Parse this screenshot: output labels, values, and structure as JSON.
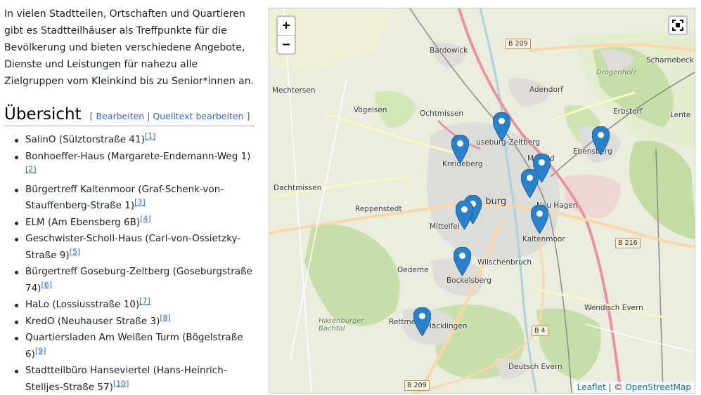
{
  "intro": "In vielen Stadtteilen, Ortschaften und Quartieren gibt es Stadtteilhäuser als Treffpunkte für die Bevölkerung und bieten verschiedene Angebote, Dienste und Leistungen für nahezu alle Zielgruppen vom Kleinkind bis zu Senior*innen an.",
  "section": {
    "title": "Übersicht",
    "bracket_open": "[",
    "edit_label": "Bearbeiten",
    "separator": "|",
    "edit_source_label": "Quelltext bearbeiten",
    "bracket_close": "]"
  },
  "items": [
    {
      "text": "SalinO (Sülztorstraße 41)",
      "ref": "[1]"
    },
    {
      "text": "Bonhoeffer-Haus (Margarete-Endemann-Weg 1)",
      "ref": "[2]"
    },
    {
      "text": "Bürgertreff Kaltenmoor (Graf-Schenk-von-Stauffenberg-Straße 1)",
      "ref": "[3]"
    },
    {
      "text": "ELM (Am Ebensberg 6B)",
      "ref": "[4]"
    },
    {
      "text": "Geschwister-Scholl-Haus (Carl-von-Ossietzky-Straße 9)",
      "ref": "[5]"
    },
    {
      "text": "Bürgertreff Goseburg-Zeltberg (Goseburgstraße 74)",
      "ref": "[6]"
    },
    {
      "text": "HaLo (Lossiusstraße 10)",
      "ref": "[7]"
    },
    {
      "text": "KredO (Neuhauser Straße 3)",
      "ref": "[8]"
    },
    {
      "text": "Quartiersladen Am Weißen Turm (Bögelstraße 6)",
      "ref": "[9]"
    },
    {
      "text": "Stadtteilbüro Hanseviertel (Hans-Heinrich-Stelljes-Straße 57)",
      "ref": "[10]"
    }
  ],
  "map": {
    "zoom_in": "+",
    "zoom_out": "−",
    "attribution_leaflet": "Leaflet",
    "attribution_sep": " | © ",
    "attribution_osm": "OpenStreetMap",
    "marker_color": "#2a81cb",
    "places": {
      "bardowick": "Bardowick",
      "scharnebeck": "Scharnebeck",
      "drogenholz": "Drogenholz",
      "mechtersen": "Mechtersen",
      "adendorf": "Adendorf",
      "vogelsen": "Vögelsen",
      "ochtmissen": "Ochtmissen",
      "erbstorf": "Erbstorf",
      "lente": "Lente",
      "goseburg": "useburg-Zeltberg",
      "kreideberg": "Kreideberg",
      "ebensberg": "Ebensberg",
      "moorfeld": "Mo   feld",
      "dachtmissen": "Dachtmissen",
      "luneburg": "L   burg",
      "neuhagen": "Neu Hagen",
      "reppenstedt": "Reppenstedt",
      "mittelfeld": "Mittelfel",
      "kaltenmoor": "Kaltenmoor",
      "oedeme": "Oedeme",
      "wilschenbruch": "Wilschenbruch",
      "bockelsberg": "Bockelsberg",
      "wendisch": "Wendisch Evern",
      "hasenburger": "Hasenburger\nBachtal",
      "rettmer": "Rettme",
      "hacklingen": "Häcklingen",
      "deutsch": "Deutsch Evern"
    },
    "roads": {
      "b209_top": "B 209",
      "b216": "B 216",
      "b4": "B 4",
      "b209_bottom": "B 209"
    }
  }
}
